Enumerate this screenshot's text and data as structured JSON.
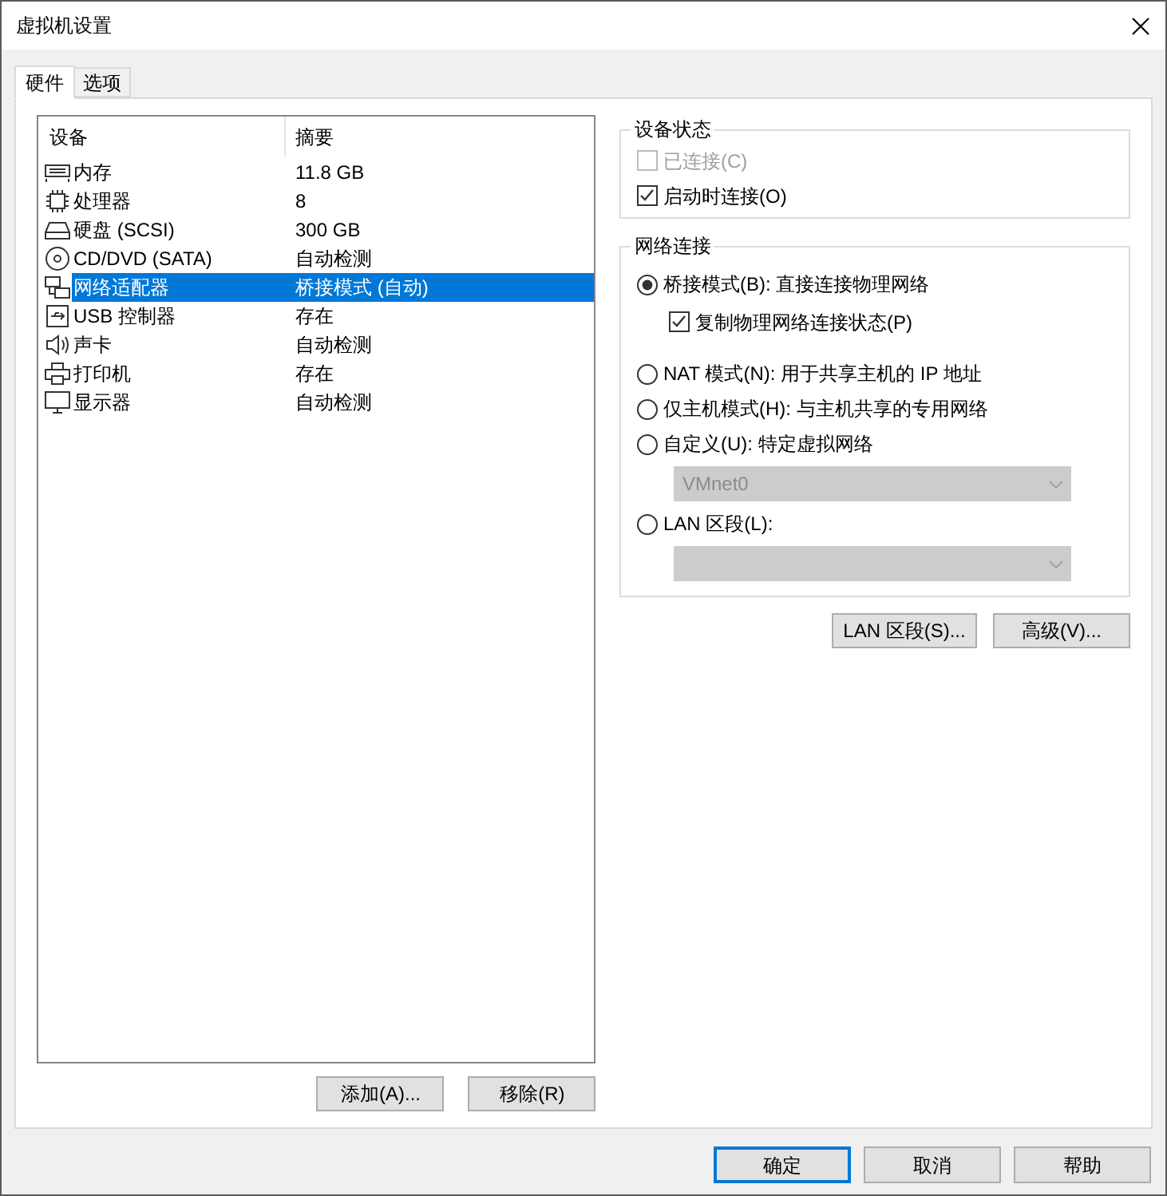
{
  "window": {
    "title": "虚拟机设置"
  },
  "tabs": [
    {
      "label": "硬件",
      "selected": true
    },
    {
      "label": "选项",
      "selected": false
    }
  ],
  "device_list": {
    "columns": [
      "设备",
      "摘要"
    ],
    "rows": [
      {
        "kind": "memory",
        "device": "内存",
        "summary": "11.8 GB",
        "selected": false
      },
      {
        "kind": "processor",
        "device": "处理器",
        "summary": "8",
        "selected": false
      },
      {
        "kind": "disk",
        "device": "硬盘 (SCSI)",
        "summary": "300 GB",
        "selected": false
      },
      {
        "kind": "cd",
        "device": "CD/DVD (SATA)",
        "summary": "自动检测",
        "selected": false
      },
      {
        "kind": "network",
        "device": "网络适配器",
        "summary": "桥接模式 (自动)",
        "selected": true
      },
      {
        "kind": "usb",
        "device": "USB 控制器",
        "summary": "存在",
        "selected": false
      },
      {
        "kind": "sound",
        "device": "声卡",
        "summary": "自动检测",
        "selected": false
      },
      {
        "kind": "printer",
        "device": "打印机",
        "summary": "存在",
        "selected": false
      },
      {
        "kind": "display",
        "device": "显示器",
        "summary": "自动检测",
        "selected": false
      }
    ]
  },
  "list_buttons": [
    "添加(A)...",
    "移除(R)"
  ],
  "device_status": {
    "title": "设备状态",
    "checkboxes": [
      {
        "label": "已连接(C)",
        "checked": false,
        "disabled": true
      },
      {
        "label": "启动时连接(O)",
        "checked": true,
        "disabled": false
      }
    ]
  },
  "network_connection": {
    "title": "网络连接",
    "options": [
      {
        "label": "桥接模式(B): 直接连接物理网络",
        "selected": true,
        "checkbox": {
          "label": "复制物理网络连接状态(P)",
          "checked": true
        }
      },
      {
        "label": "NAT 模式(N): 用于共享主机的 IP 地址",
        "selected": false
      },
      {
        "label": "仅主机模式(H): 与主机共享的专用网络",
        "selected": false
      },
      {
        "label": "自定义(U): 特定虚拟网络",
        "selected": false,
        "dropdown": {
          "value": "VMnet0",
          "disabled": true
        }
      },
      {
        "label": "LAN 区段(L):",
        "selected": false,
        "dropdown": {
          "disabled": true
        }
      }
    ]
  },
  "panel_buttons": [
    "LAN 区段(S)...",
    "高级(V)..."
  ],
  "dialog_buttons": [
    {
      "label": "确定",
      "focused": true
    },
    {
      "label": "取消",
      "focused": false
    },
    {
      "label": "帮助",
      "focused": false
    }
  ]
}
